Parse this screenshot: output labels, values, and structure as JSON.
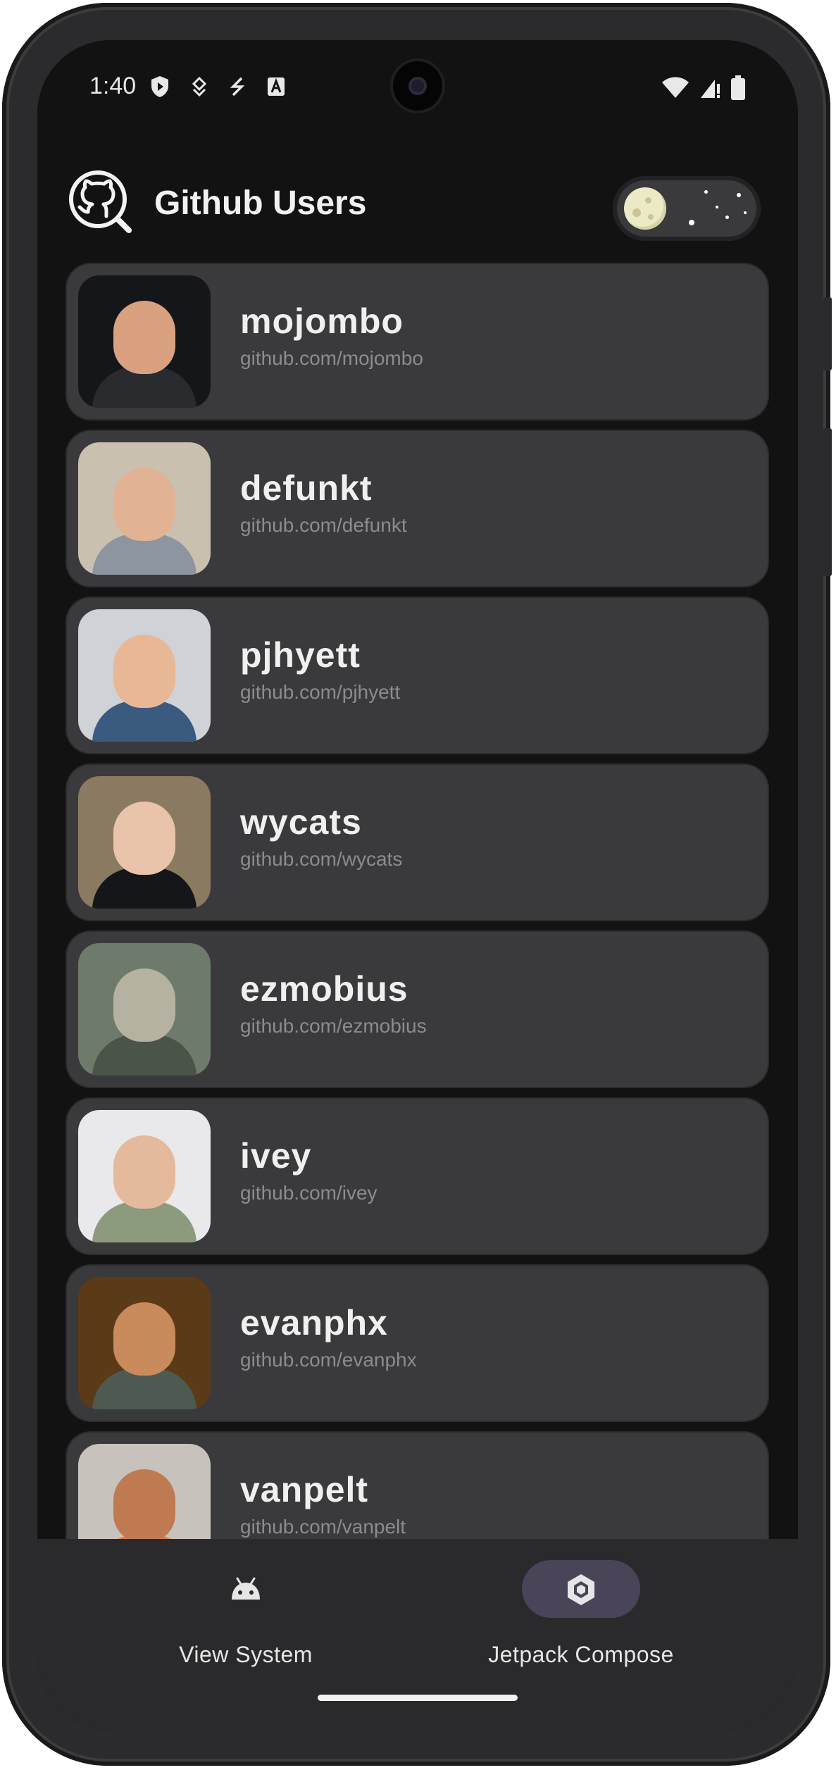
{
  "status_bar": {
    "time": "1:40",
    "left_icons": [
      "shield-icon",
      "notification-icon",
      "sync-icon",
      "text-icon"
    ],
    "right_icons": [
      "wifi-icon",
      "signal-icon",
      "battery-icon"
    ]
  },
  "header": {
    "title": "Github Users",
    "logo_icon": "github-search-icon",
    "theme_toggle": {
      "mode": "dark"
    }
  },
  "users": [
    {
      "login": "mojombo",
      "url": "github.com/mojombo",
      "bg": "#15161a",
      "skin": "#d9a17f",
      "shirt": "#2a2b2f"
    },
    {
      "login": "defunkt",
      "url": "github.com/defunkt",
      "bg": "#c9c0b0",
      "skin": "#e1b394",
      "shirt": "#8c95a0"
    },
    {
      "login": "pjhyett",
      "url": "github.com/pjhyett",
      "bg": "#cfd2d6",
      "skin": "#e8b896",
      "shirt": "#3b5a80"
    },
    {
      "login": "wycats",
      "url": "github.com/wycats",
      "bg": "#8a7a62",
      "skin": "#e9c3aa",
      "shirt": "#15161a"
    },
    {
      "login": "ezmobius",
      "url": "github.com/ezmobius",
      "bg": "#6f7b6a",
      "skin": "#b6b2a2",
      "shirt": "#4a5448"
    },
    {
      "login": "ivey",
      "url": "github.com/ivey",
      "bg": "#e9e9ec",
      "skin": "#e5b99b",
      "shirt": "#8c9a7e"
    },
    {
      "login": "evanphx",
      "url": "github.com/evanphx",
      "bg": "#5b3a18",
      "skin": "#c98a5c",
      "shirt": "#4d5a52"
    },
    {
      "login": "vanpelt",
      "url": "github.com/vanpelt",
      "bg": "#c7c2bc",
      "skin": "#c07a52",
      "shirt": "#e07a3a"
    }
  ],
  "bottom_nav": {
    "items": [
      {
        "label": "View System",
        "icon": "android-icon",
        "selected": false
      },
      {
        "label": "Jetpack Compose",
        "icon": "compose-icon",
        "selected": true
      }
    ],
    "selected_pill_color": "#4a4458"
  }
}
